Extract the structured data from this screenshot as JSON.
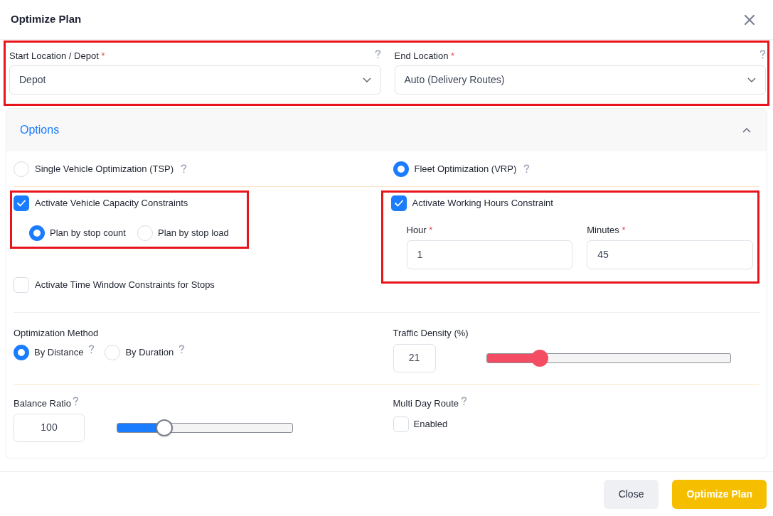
{
  "dialog": {
    "title": "Optimize Plan"
  },
  "locations": {
    "highlighted": true,
    "fields": [
      {
        "label": "Start Location / Depot",
        "mark": "*",
        "value": "Depot",
        "help": true
      },
      {
        "label": "End Location",
        "mark": "*",
        "value": "Auto (Delivery Routes)",
        "help": true
      }
    ]
  },
  "options": {
    "title": "Options",
    "expanded": true,
    "mode": [
      {
        "label": "Single Vehicle Optimization (TSP)",
        "selected": false,
        "help": true
      },
      {
        "label": "Fleet Optimization (VRP)",
        "selected": true,
        "help": true
      }
    ],
    "capacity": {
      "label": "Activate Vehicle Capacity Constraints",
      "checked": true,
      "highlighted": true,
      "plan_by": [
        {
          "label": "Plan by stop count",
          "selected": true
        },
        {
          "label": "Plan by stop load",
          "selected": false
        }
      ]
    },
    "working_hours": {
      "label": "Activate Working Hours Constraint",
      "checked": true,
      "highlighted": true,
      "fields": [
        {
          "label": "Hour",
          "mark": "*",
          "value": "1"
        },
        {
          "label": "Minutes",
          "mark": "*",
          "value": "45"
        }
      ]
    },
    "time_window": {
      "label": "Activate Time Window Constraints for Stops",
      "checked": false
    },
    "method": {
      "label": "Optimization Method",
      "choices": [
        {
          "label": "By Distance",
          "selected": true,
          "help": true
        },
        {
          "label": "By Duration",
          "selected": false,
          "help": true
        }
      ]
    },
    "traffic": {
      "label": "Traffic Density (%)",
      "value": "21",
      "level": 0.22
    },
    "balance": {
      "label": "Balance Ratio",
      "help": true,
      "value": "100",
      "level": 0.27
    },
    "multi_day": {
      "label": "Multi Day Route",
      "help": true,
      "checkbox_label": "Enabled",
      "checked": false
    }
  },
  "buttons": [
    {
      "label": "Close",
      "kind": "secondary"
    },
    {
      "label": "Optimize Plan",
      "kind": "primary"
    }
  ]
}
